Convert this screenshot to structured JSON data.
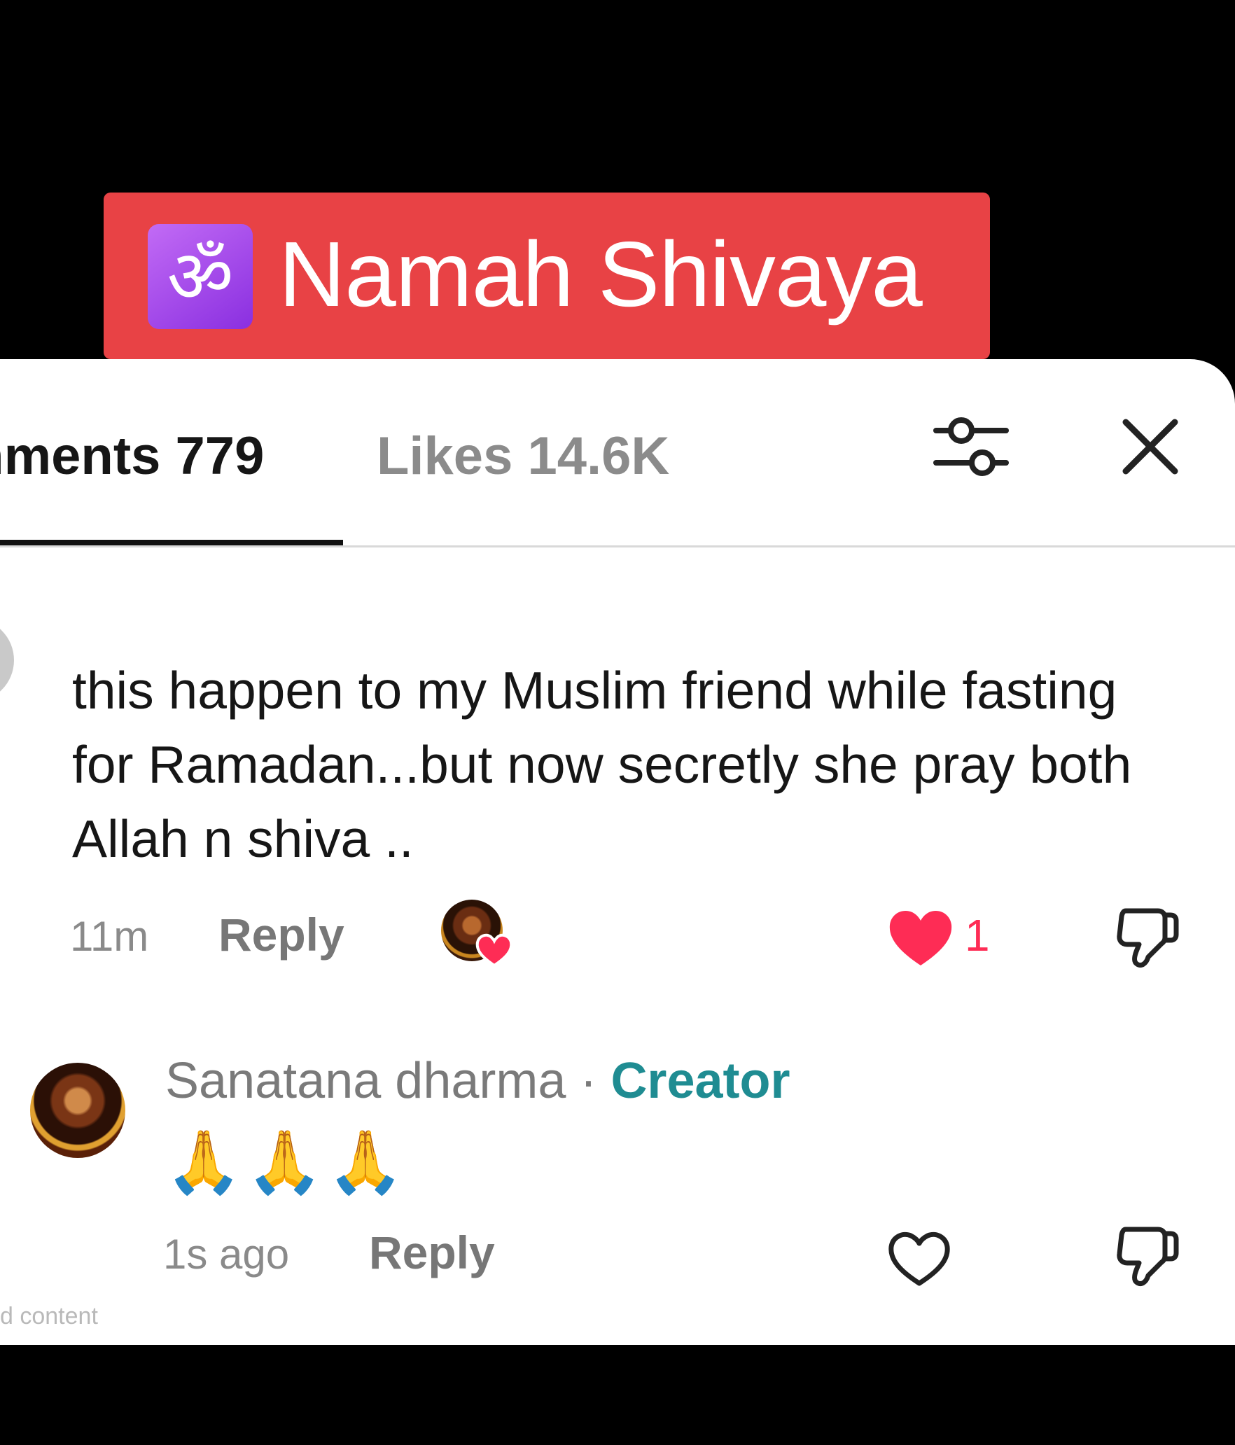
{
  "banner": {
    "om_symbol": "ॐ",
    "title": "Namah Shivaya"
  },
  "tabs": {
    "comments_label": "mments 779",
    "likes_label": "Likes 14.6K"
  },
  "icons": {
    "filter": "sliders-icon",
    "close": "close-icon",
    "like": "heart-icon",
    "dislike": "thumbs-down-icon"
  },
  "comment": {
    "text": "this happen to my Muslim friend while fasting for Ramadan...but now secretly she pray both Allah n shiva ..",
    "time": "11m",
    "reply_label": "Reply",
    "like_count": "1",
    "liked_by_creator": true
  },
  "reply": {
    "author": "Sanatana dharma",
    "separator": "·",
    "badge": "Creator",
    "text": "🙏🙏🙏",
    "time": "1s ago",
    "reply_label": "Reply"
  },
  "footer": {
    "note": "d content"
  },
  "colors": {
    "banner": "#e84245",
    "like_red": "#fe2c55",
    "creator_teal": "#1f8c92"
  }
}
